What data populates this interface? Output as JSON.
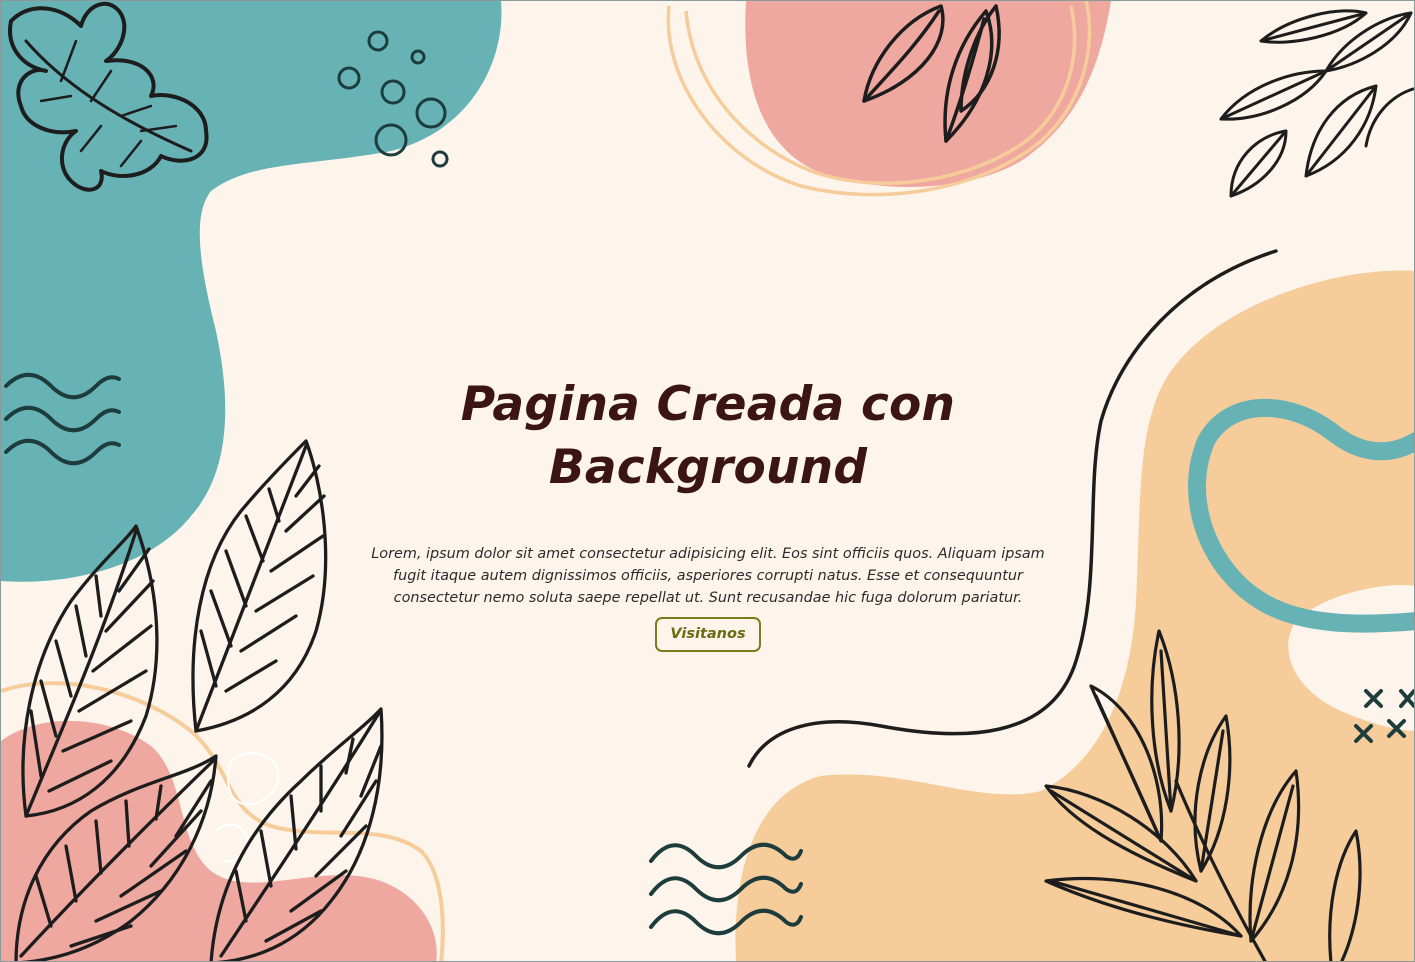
{
  "hero": {
    "title_line1": "Pagina Creada con",
    "title_line2": "Background",
    "paragraph": "Lorem, ipsum dolor sit amet consectetur adipisicing elit. Eos sint officiis quos. Aliquam ipsam fugit itaque autem dignissimos officiis, asperiores corrupti natus. Esse et consequuntur consectetur nemo soluta saepe repellat ut. Sunt recusandae hic fuga dolorum pariatur.",
    "button_label": "Visitanos"
  },
  "colors": {
    "background": "#fdf5eb",
    "teal": "#67b2b5",
    "pink": "#efa8a0",
    "peach": "#f6cc9b",
    "ink": "#1f1f1f",
    "title": "#3b1414",
    "button": "#7f7b1c"
  }
}
